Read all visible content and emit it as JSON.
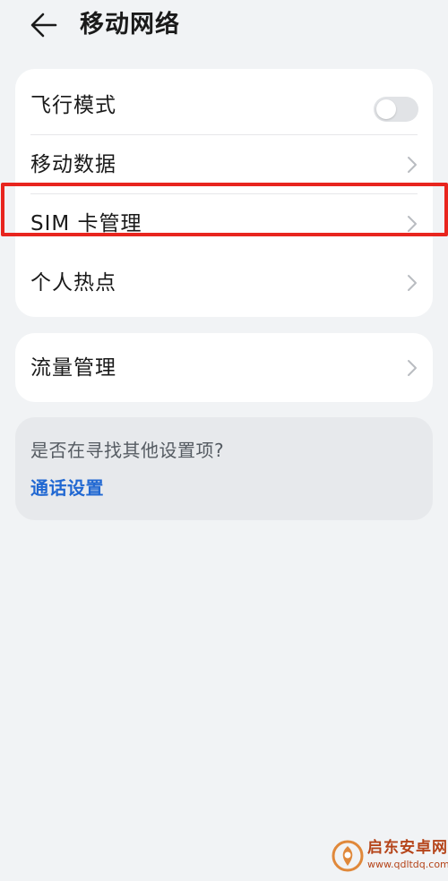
{
  "header": {
    "title": "移动网络"
  },
  "network_card": {
    "items": [
      {
        "label": "飞行模式",
        "control": "toggle",
        "enabled": false
      },
      {
        "label": "移动数据",
        "control": "chevron"
      },
      {
        "label": "SIM 卡管理",
        "control": "chevron",
        "highlighted": true
      },
      {
        "label": "个人热点",
        "control": "chevron"
      }
    ]
  },
  "traffic_card": {
    "label": "流量管理"
  },
  "suggestion": {
    "prompt": "是否在寻找其他设置项?",
    "link": "通话设置"
  },
  "watermark": {
    "name": "启东安卓网",
    "url": "www.qdltdq.com"
  },
  "colors": {
    "background": "#f1f3f5",
    "card": "#ffffff",
    "link": "#2168d2",
    "highlight": "#e8251e",
    "toggle_off": "#e1e3e6"
  },
  "icons": {
    "back": "arrow-left-icon",
    "chevron": "chevron-right-icon"
  }
}
